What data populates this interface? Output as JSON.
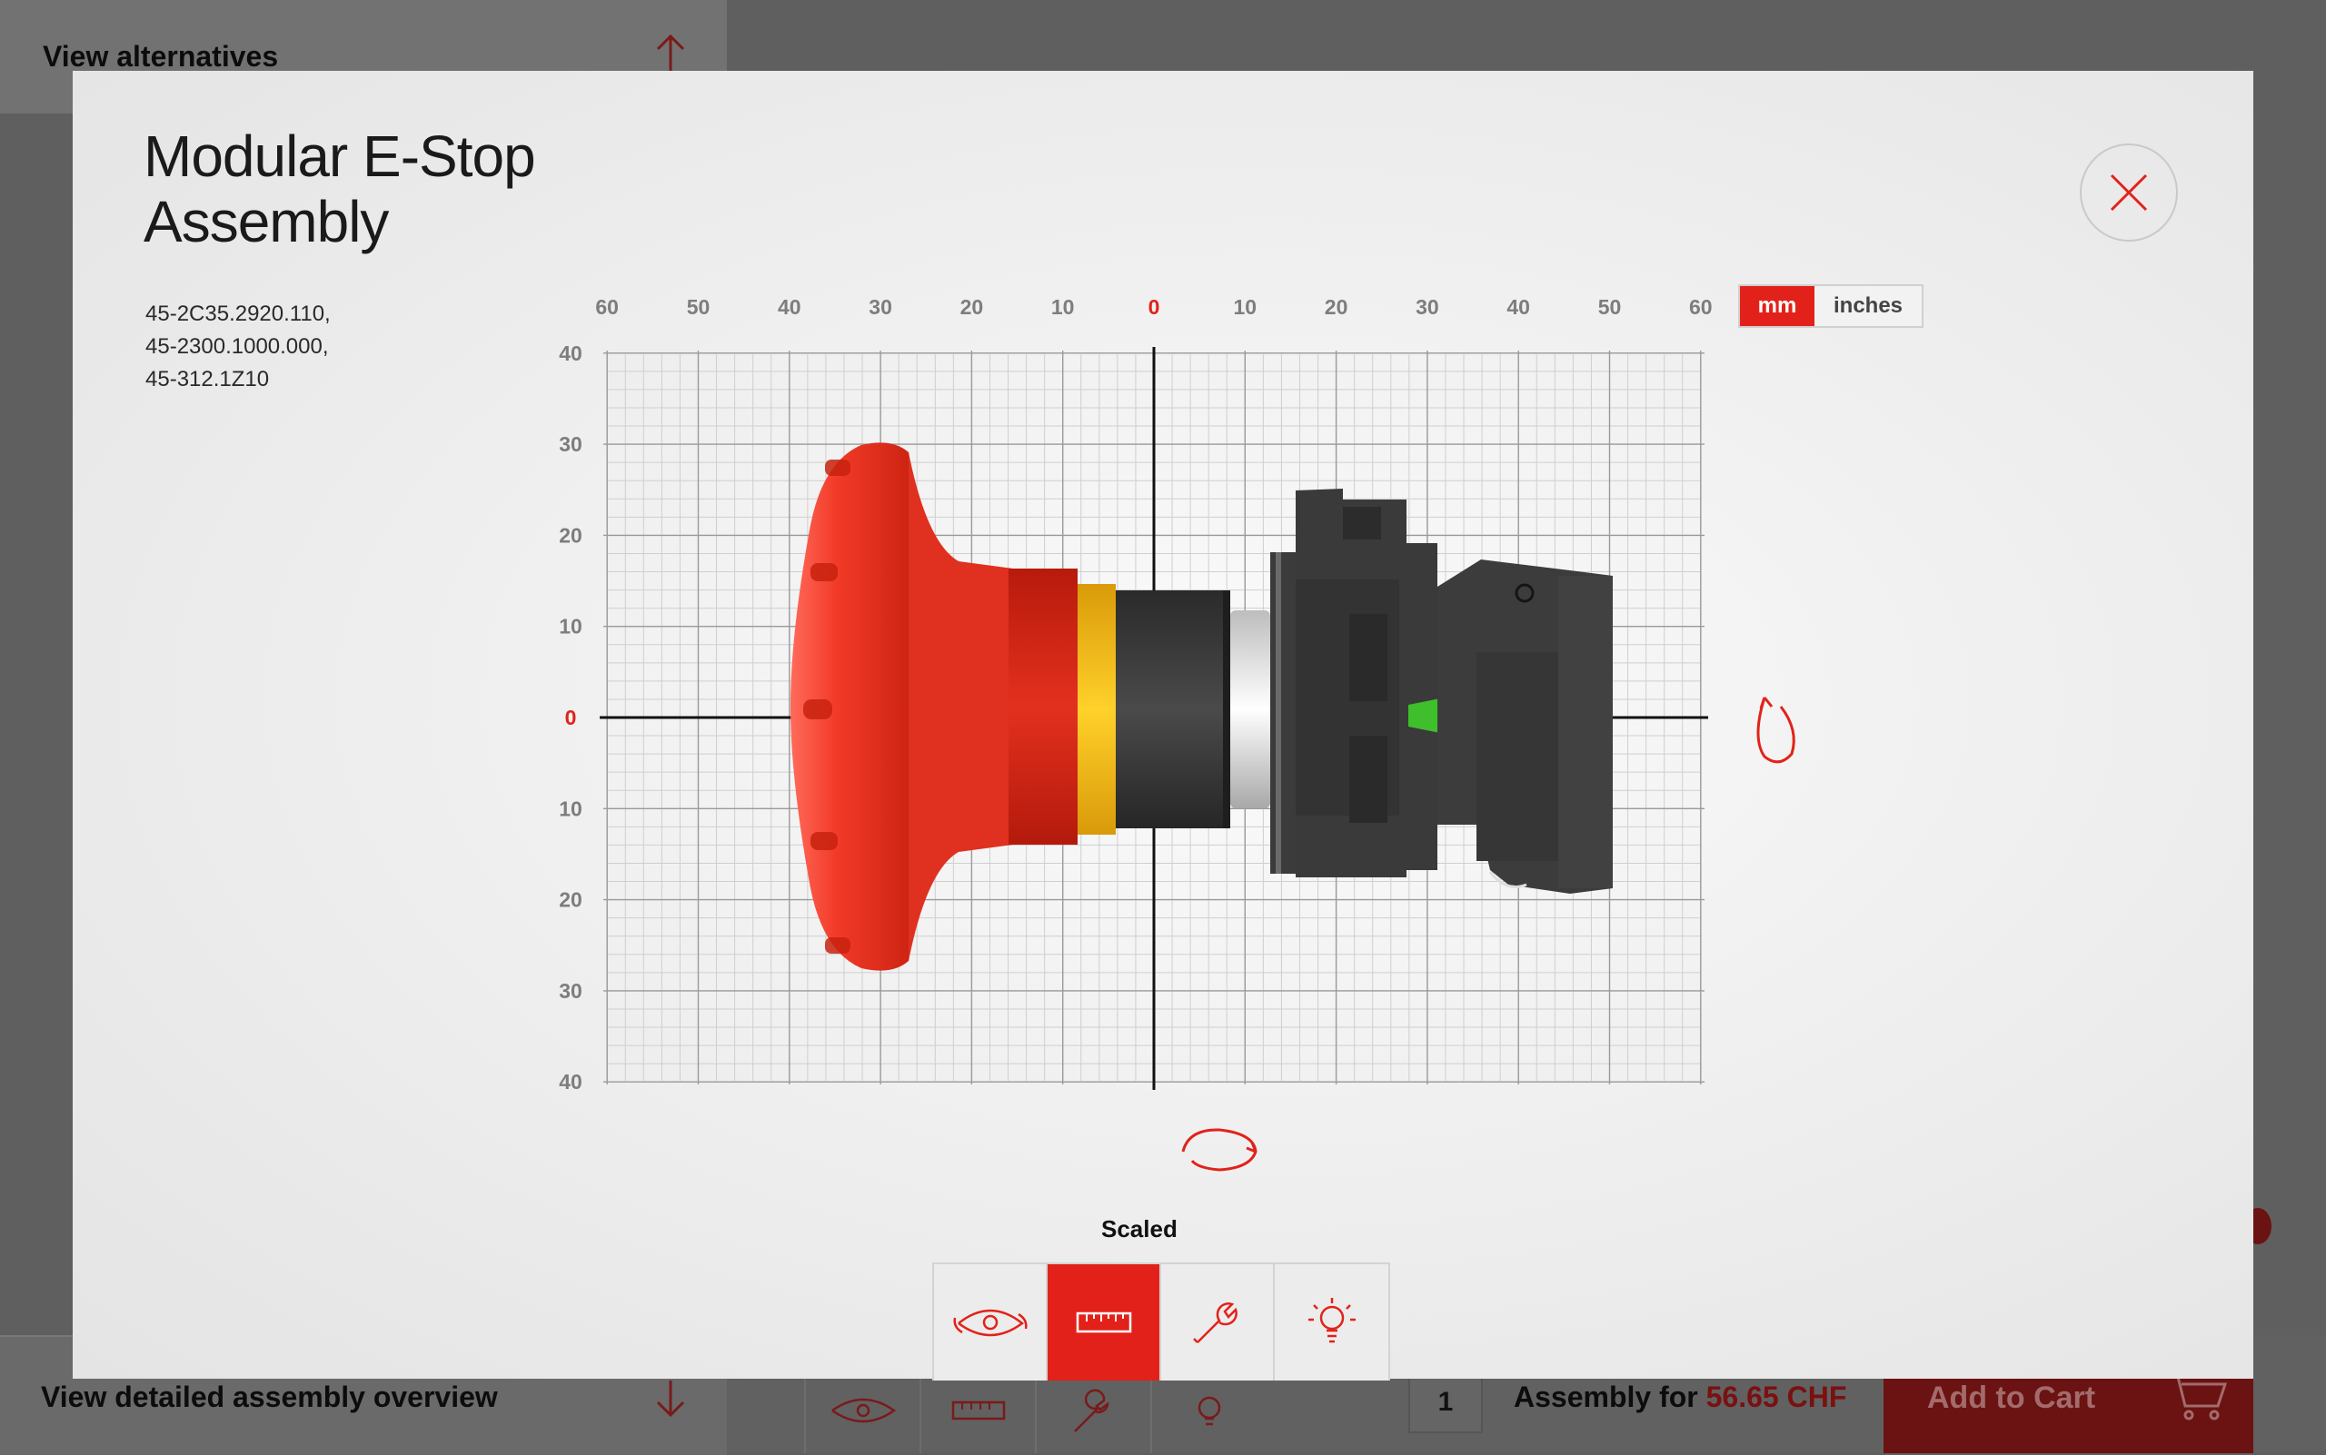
{
  "background": {
    "view_alternatives": "View alternatives",
    "view_overview": "View detailed assembly overview",
    "quantity": "1",
    "assembly_prefix": "Assembly for",
    "price": "56.65 CHF",
    "add_to_cart": "Add to Cart"
  },
  "modal": {
    "title_line1": "Modular E-Stop",
    "title_line2": "Assembly",
    "part_numbers": [
      "45-2C35.2920.110,",
      "45-2300.1000.000,",
      "45-312.1Z10"
    ],
    "units": {
      "mm": "mm",
      "inches": "inches",
      "selected": "mm"
    },
    "mode_label": "Scaled",
    "modes": [
      {
        "name": "rotate-view",
        "icon": "eye-rotate-icon",
        "active": false
      },
      {
        "name": "scaled",
        "icon": "ruler-icon",
        "active": true
      },
      {
        "name": "assembly",
        "icon": "wrench-icon",
        "active": false
      },
      {
        "name": "illuminated",
        "icon": "lightbulb-icon",
        "active": false
      }
    ]
  },
  "ruler": {
    "x_ticks": [
      "60",
      "50",
      "40",
      "30",
      "20",
      "10",
      "0",
      "10",
      "20",
      "30",
      "40",
      "50",
      "60"
    ],
    "y_ticks": [
      "40",
      "30",
      "20",
      "10",
      "0",
      "10",
      "20",
      "30",
      "40"
    ]
  },
  "colors": {
    "accent": "#e2221a",
    "button_red": "#e53122",
    "collar_yellow": "#f5c21b",
    "indicator_green": "#3fbf2c",
    "housing_dark": "#3a3a3a"
  }
}
